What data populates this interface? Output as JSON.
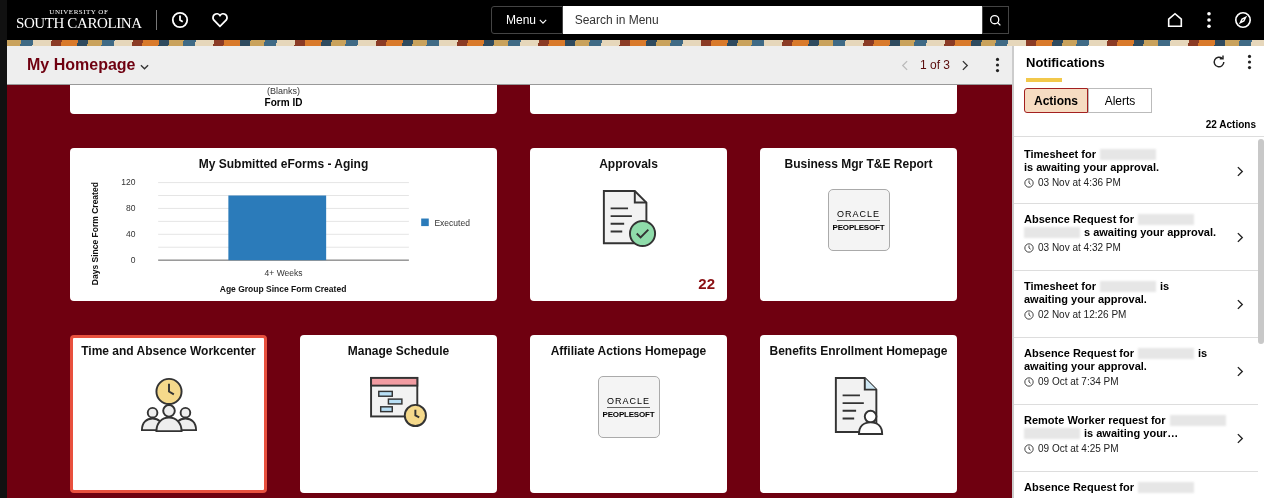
{
  "topbar": {
    "logo": {
      "line1": "UNIVERSITY OF",
      "line2": "SOUTH CAROLINA"
    },
    "menu_button": "Menu",
    "search": {
      "placeholder": "Search in Menu"
    }
  },
  "page_header": {
    "title": "My Homepage",
    "pager": {
      "text": "1 of 3",
      "prev_disabled": true,
      "next_disabled": false
    }
  },
  "tiles": [
    {
      "kind": "partial",
      "selected": false,
      "lines": [
        "(Blanks)",
        "Form ID"
      ]
    },
    {
      "kind": "partial",
      "selected": false
    },
    {
      "kind": "chart",
      "selected": false,
      "chart_data": {
        "type": "bar",
        "title": "My Submitted eForms - Aging",
        "xlabel": "Age Group Since Form Created",
        "ylabel": "Days Since Form Created",
        "categories": [
          "4+ Weeks"
        ],
        "series": [
          {
            "name": "Executed",
            "color": "#2b7bba",
            "values": [
              100
            ]
          }
        ],
        "ylim": [
          0,
          120
        ],
        "yticks": [
          0,
          40,
          80,
          120
        ]
      }
    },
    {
      "kind": "approvals",
      "selected": false,
      "title": "Approvals",
      "count": "22"
    },
    {
      "kind": "oracle",
      "selected": false,
      "title": "Business Mgr T&E Report",
      "logo": {
        "line1": "ORACLE",
        "line2": "PEOPLESOFT"
      }
    },
    {
      "kind": "people-clock",
      "selected": true,
      "title": "Time and Absence Workcenter"
    },
    {
      "kind": "schedule",
      "selected": false,
      "title": "Manage Schedule"
    },
    {
      "kind": "oracle",
      "selected": false,
      "title": "Affiliate Actions Homepage",
      "logo": {
        "line1": "ORACLE",
        "line2": "PEOPLESOFT"
      }
    },
    {
      "kind": "document-person",
      "selected": false,
      "title": "Benefits Enrollment Homepage"
    }
  ],
  "notifications": {
    "title": "Notifications",
    "tabs": [
      {
        "label": "Actions",
        "selected": true
      },
      {
        "label": "Alerts",
        "selected": false
      }
    ],
    "count": "22 Actions",
    "items": [
      {
        "lines": [
          [
            {
              "kind": "text",
              "text": "Timesheet for"
            },
            {
              "kind": "redacted"
            }
          ],
          [
            {
              "kind": "text",
              "text": "is awaiting your approval."
            }
          ]
        ],
        "time": "03 Nov at 4:36 PM"
      },
      {
        "lines": [
          [
            {
              "kind": "text",
              "text": "Absence Request for"
            },
            {
              "kind": "redacted"
            }
          ],
          [
            {
              "kind": "redacted"
            },
            {
              "kind": "text",
              "text": "s awaiting your approval."
            }
          ]
        ],
        "time": "03 Nov at 4:32 PM"
      },
      {
        "lines": [
          [
            {
              "kind": "text",
              "text": "Timesheet for"
            },
            {
              "kind": "redacted"
            },
            {
              "kind": "text",
              "text": "is"
            }
          ],
          [
            {
              "kind": "text",
              "text": "awaiting your approval."
            }
          ]
        ],
        "time": "02 Nov at 12:26 PM"
      },
      {
        "lines": [
          [
            {
              "kind": "text",
              "text": "Absence Request for"
            },
            {
              "kind": "redacted"
            },
            {
              "kind": "text",
              "text": "is"
            }
          ],
          [
            {
              "kind": "text",
              "text": "awaiting your approval."
            }
          ]
        ],
        "time": "09 Oct at 7:34 PM"
      },
      {
        "lines": [
          [
            {
              "kind": "text",
              "text": "Remote Worker request for"
            },
            {
              "kind": "redacted"
            }
          ],
          [
            {
              "kind": "redacted"
            },
            {
              "kind": "text",
              "text": "is awaiting your…"
            }
          ]
        ],
        "time": "09 Oct at 4:25 PM"
      },
      {
        "lines": [
          [
            {
              "kind": "text",
              "text": "Absence Request for"
            },
            {
              "kind": "redacted"
            }
          ]
        ]
      }
    ]
  }
}
